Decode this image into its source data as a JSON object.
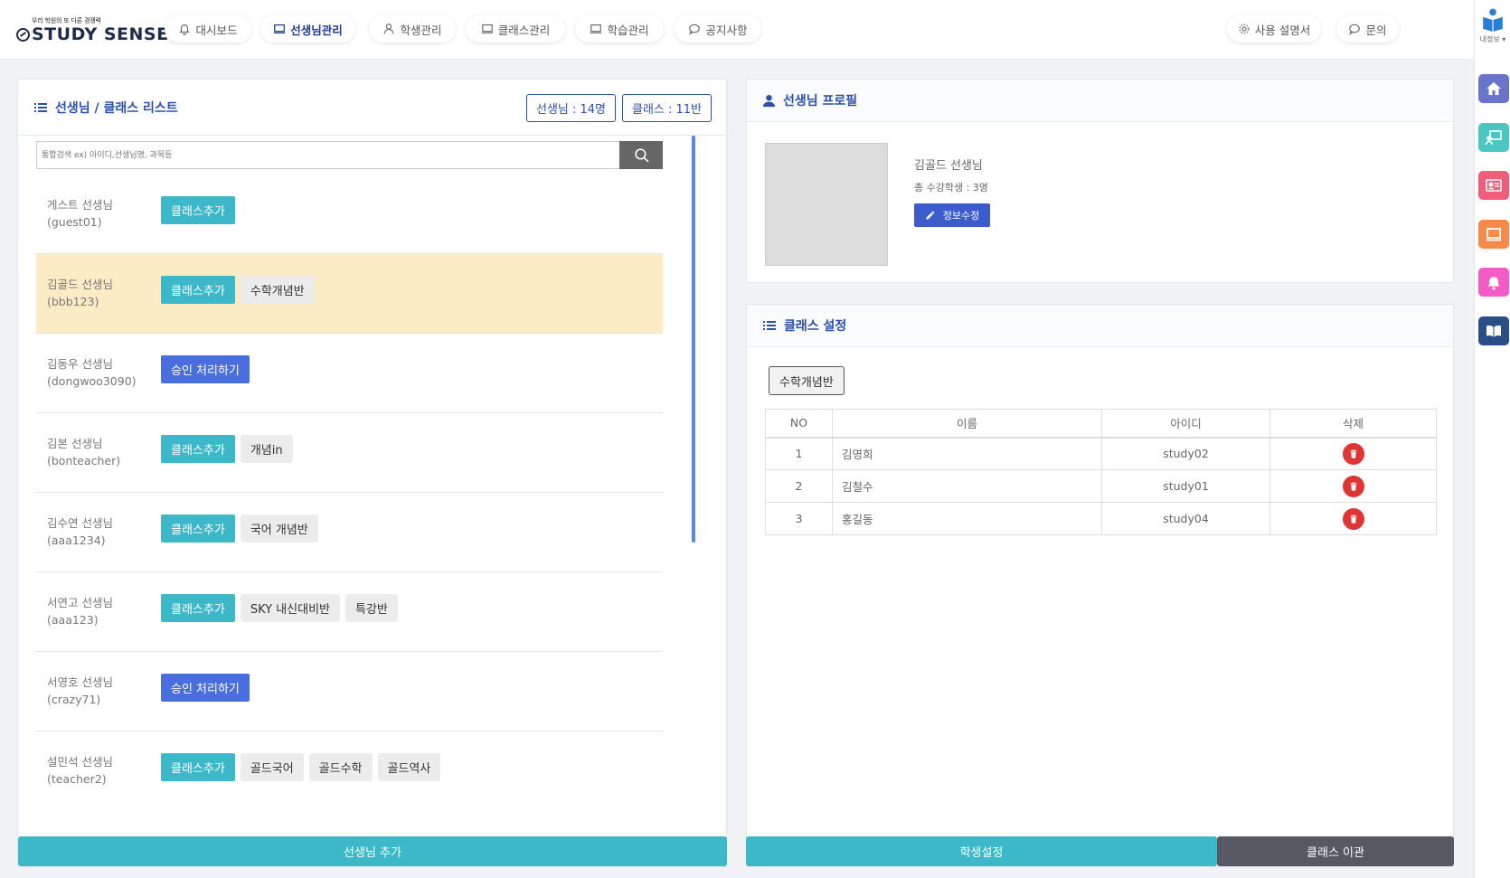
{
  "header": {
    "tagline": "우리 학원의 또 다른 경쟁력",
    "brand": "STUDY SENSE",
    "nav": [
      {
        "label": "대시보드",
        "icon": "bell-icon"
      },
      {
        "label": "선생님관리",
        "icon": "monitor-icon",
        "active": true
      },
      {
        "label": "학생관리",
        "icon": "user-icon"
      },
      {
        "label": "클래스관리",
        "icon": "monitor-icon"
      },
      {
        "label": "학습관리",
        "icon": "monitor-icon"
      },
      {
        "label": "공지사항",
        "icon": "chat-icon"
      }
    ],
    "manual_label": "사용 설명서",
    "inquiry_label": "문의"
  },
  "rightbar": {
    "profile_label": "내정보",
    "icons": [
      {
        "name": "home-icon",
        "color": "#6a74c9"
      },
      {
        "name": "teacher-board-icon",
        "color": "#4cc6c0"
      },
      {
        "name": "id-card-icon",
        "color": "#f05d78"
      },
      {
        "name": "screen-icon",
        "color": "#f58a4b"
      },
      {
        "name": "bell-icon",
        "color": "#f25cc4"
      },
      {
        "name": "book-icon",
        "color": "#2a4e86"
      }
    ]
  },
  "teacher_list": {
    "title": "선생님 / 클래스 리스트",
    "teacher_count": "선생님 : 14명",
    "class_count": "클래스 : 11반",
    "search_placeholder": "통합검색 ex) 아이디,선생님명, 과목등",
    "add_class_label": "클래스추가",
    "approve_label": "승인 처리하기",
    "rows": [
      {
        "name": "게스트 선생님",
        "id": "(guest01)",
        "type": "add",
        "classes": []
      },
      {
        "name": "김골드 선생님",
        "id": "(bbb123)",
        "type": "add",
        "classes": [
          "수학개념반"
        ],
        "selected": true
      },
      {
        "name": "김동우 선생님",
        "id": "(dongwoo3090)",
        "type": "approve",
        "classes": []
      },
      {
        "name": "김본 선생님",
        "id": "(bonteacher)",
        "type": "add",
        "classes": [
          "개념in"
        ]
      },
      {
        "name": "김수연 선생님",
        "id": "(aaa1234)",
        "type": "add",
        "classes": [
          "국어 개념반"
        ]
      },
      {
        "name": "서연고 선생님",
        "id": "(aaa123)",
        "type": "add",
        "classes": [
          "SKY 내신대비반",
          "특강반"
        ]
      },
      {
        "name": "서영호 선생님",
        "id": "(crazy71)",
        "type": "approve",
        "classes": []
      },
      {
        "name": "설민석 선생님",
        "id": "(teacher2)",
        "type": "add",
        "classes": [
          "골드국어",
          "골드수학",
          "골드역사"
        ]
      }
    ],
    "add_teacher_label": "선생님 추가"
  },
  "profile": {
    "title": "선생님 프로필",
    "name": "김골드 선생님",
    "students": "총 수강학생 : 3명",
    "edit_label": "정보수정"
  },
  "class_settings": {
    "title": "클래스 설정",
    "selected_class": "수학개념반",
    "columns": [
      "NO",
      "이름",
      "아이디",
      "삭제"
    ],
    "students": [
      {
        "no": "1",
        "name": "김영희",
        "id": "study02"
      },
      {
        "no": "2",
        "name": "김철수",
        "id": "study01"
      },
      {
        "no": "3",
        "name": "홍길동",
        "id": "study04"
      }
    ],
    "student_settings_label": "학생설정",
    "class_transfer_label": "클래스 이관"
  },
  "colors": {
    "accent": "#2c4fa8",
    "teal": "#3db8c8",
    "approve": "#4a6fdc",
    "selected_row": "#fbecc6",
    "danger": "#e03535",
    "dark_button": "#565863"
  }
}
